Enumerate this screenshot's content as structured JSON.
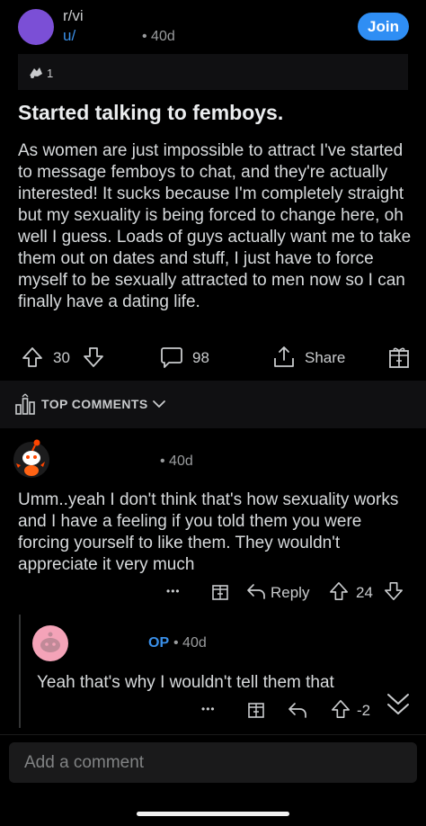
{
  "post": {
    "subreddit": "r/vi",
    "user": "u/",
    "time": "• 40d",
    "join_label": "Join",
    "award_count": "1",
    "title": "Started talking to femboys.",
    "body": "As women are just impossible to attract I've started to message femboys to chat, and they're actually interested! It sucks because I'm completely straight but my sexuality is being forced to change here, oh well I guess. Loads of guys actually want me to take them out on dates and stuff, I just have to force myself to be sexually attracted to men now so I can finally have a dating life.",
    "votes": "30",
    "comments": "98",
    "share_label": "Share"
  },
  "top_comments_label": "TOP COMMENTS",
  "comments": [
    {
      "time": "• 40d",
      "text": "Umm..yeah I don't think that's how sexuality works and I have a feeling if you told them you were forcing yourself to like them. They wouldn't appreciate it very much",
      "more": "•••",
      "reply_label": "Reply",
      "votes": "24"
    },
    {
      "op_label": "OP",
      "time": "• 40d",
      "text": "Yeah that's why I wouldn't tell them that",
      "more": "•••",
      "votes": "-2"
    }
  ],
  "add_comment_placeholder": "Add a comment",
  "colors": {
    "background": "#000000",
    "accent_blue": "#2f8ef4",
    "subreddit_avatar": "#7b4fd6",
    "op_label": "#3a8fe8"
  },
  "icons": [
    "award-icon",
    "upvote-icon",
    "downvote-icon",
    "comment-icon",
    "share-icon",
    "gift-icon",
    "top-comments-icon",
    "chevron-down-icon",
    "reply-icon",
    "collapse-icon"
  ]
}
